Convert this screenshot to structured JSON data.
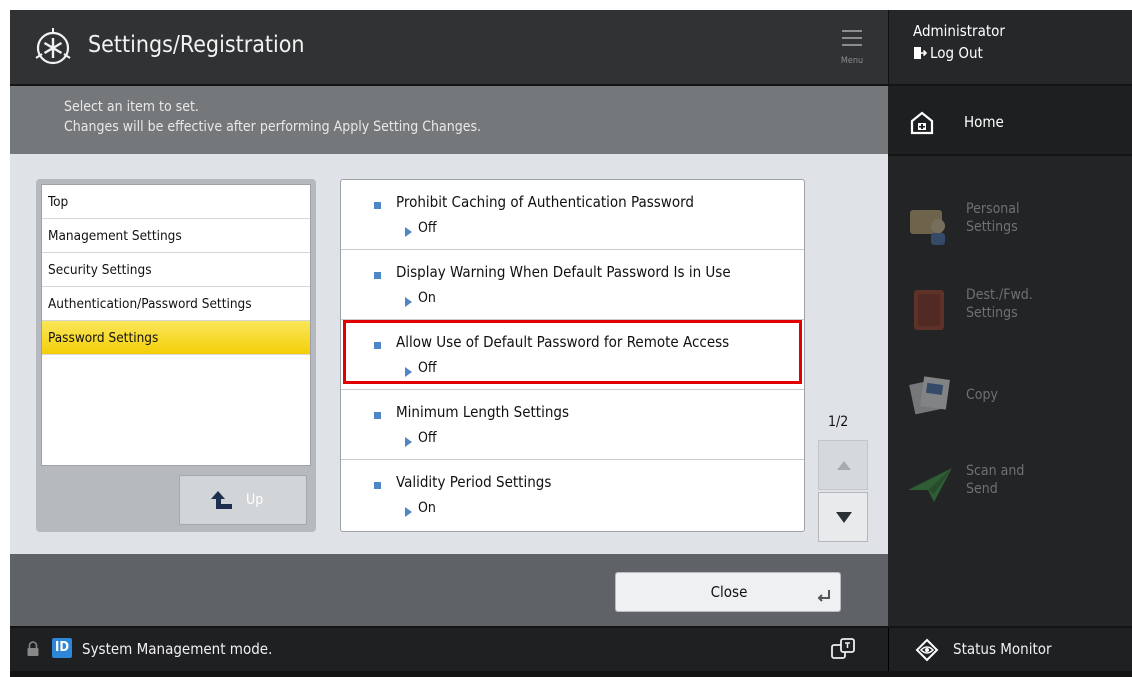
{
  "header": {
    "title": "Settings/Registration",
    "menu_label": "Menu"
  },
  "account": {
    "user": "Administrator",
    "logout_label": "Log Out"
  },
  "home": {
    "label": "Home"
  },
  "apps": [
    {
      "label_line1": "Personal",
      "label_line2": "Settings",
      "icon": "personal-settings-icon"
    },
    {
      "label_line1": "Dest./Fwd.",
      "label_line2": "Settings",
      "icon": "address-book-icon"
    },
    {
      "label_line1": "Copy",
      "label_line2": "",
      "icon": "copy-icon"
    },
    {
      "label_line1": "Scan and",
      "label_line2": "Send",
      "icon": "scan-send-icon"
    }
  ],
  "instructions": {
    "line1": "Select an item to set.",
    "line2": "Changes will be effective after performing Apply Setting Changes."
  },
  "tree": {
    "items": [
      {
        "label": "Top"
      },
      {
        "label": "Management Settings"
      },
      {
        "label": "Security Settings"
      },
      {
        "label": "Authentication/Password Settings"
      },
      {
        "label": "Password Settings",
        "selected": true
      }
    ],
    "up_label": "Up"
  },
  "settings": [
    {
      "name": "Prohibit Caching of Authentication Password",
      "value": "Off"
    },
    {
      "name": "Display Warning When Default Password Is in Use",
      "value": "On"
    },
    {
      "name": "Allow Use of Default Password for Remote Access",
      "value": "Off",
      "highlighted": true
    },
    {
      "name": "Minimum Length Settings",
      "value": "Off"
    },
    {
      "name": "Validity Period Settings",
      "value": "On"
    }
  ],
  "pager": {
    "page": "1/2"
  },
  "close_label": "Close",
  "status": {
    "id_badge": "ID",
    "mode_text": "System Management mode.",
    "monitor_label": "Status Monitor"
  },
  "colors": {
    "accent_blue": "#4f86c6",
    "selected_yellow": "#f4cf08",
    "highlight_red": "#e00000"
  }
}
